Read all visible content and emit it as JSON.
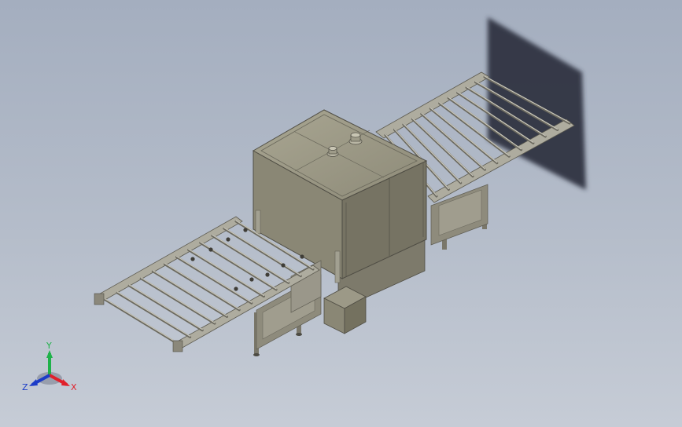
{
  "triad": {
    "x_label": "X",
    "y_label": "Y",
    "z_label": "Z",
    "x_color": "#e0202a",
    "y_color": "#1fb24a",
    "z_color": "#1c3cc8"
  },
  "colors": {
    "body": "#8f8b78",
    "body_dark": "#6e6b5d",
    "body_light": "#aaa795",
    "frame": "#9a978a",
    "shadow": "#2d3240"
  },
  "icons": [
    "coordinate-triad-icon"
  ]
}
